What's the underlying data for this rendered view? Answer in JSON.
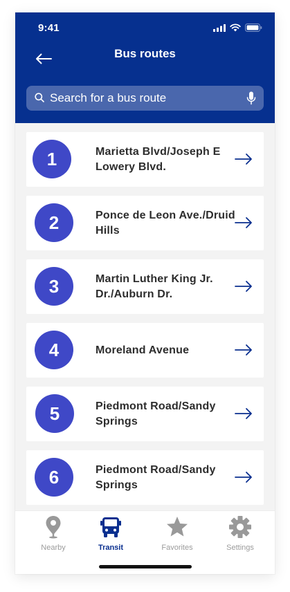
{
  "status_bar": {
    "time": "9:41"
  },
  "header": {
    "title": "Bus routes",
    "back_icon": "arrow-left-icon"
  },
  "search": {
    "placeholder": "Search for a bus route",
    "value": "",
    "icon": "search-icon",
    "mic_icon": "microphone-icon"
  },
  "routes": [
    {
      "number": "1",
      "name": "Marietta Blvd/Joseph E Lowery Blvd."
    },
    {
      "number": "2",
      "name": "Ponce de Leon Ave./Druid Hills"
    },
    {
      "number": "3",
      "name": "Martin Luther King Jr. Dr./Auburn Dr."
    },
    {
      "number": "4",
      "name": "Moreland Avenue"
    },
    {
      "number": "5",
      "name": "Piedmont Road/Sandy Springs"
    },
    {
      "number": "6",
      "name": "Piedmont Road/Sandy Springs"
    }
  ],
  "tabs": [
    {
      "label": "Nearby",
      "icon": "map-pin-icon",
      "active": false
    },
    {
      "label": "Transit",
      "icon": "bus-icon",
      "active": true
    },
    {
      "label": "Favorites",
      "icon": "star-icon",
      "active": false
    },
    {
      "label": "Settings",
      "icon": "gear-icon",
      "active": false
    }
  ],
  "colors": {
    "header_bg": "#06308f",
    "search_bg": "#4a67ad",
    "route_badge": "#3f48c7",
    "active_tab": "#0a2f8f",
    "inactive_tab": "#9b9b9b",
    "list_bg": "#f3f3f3"
  }
}
